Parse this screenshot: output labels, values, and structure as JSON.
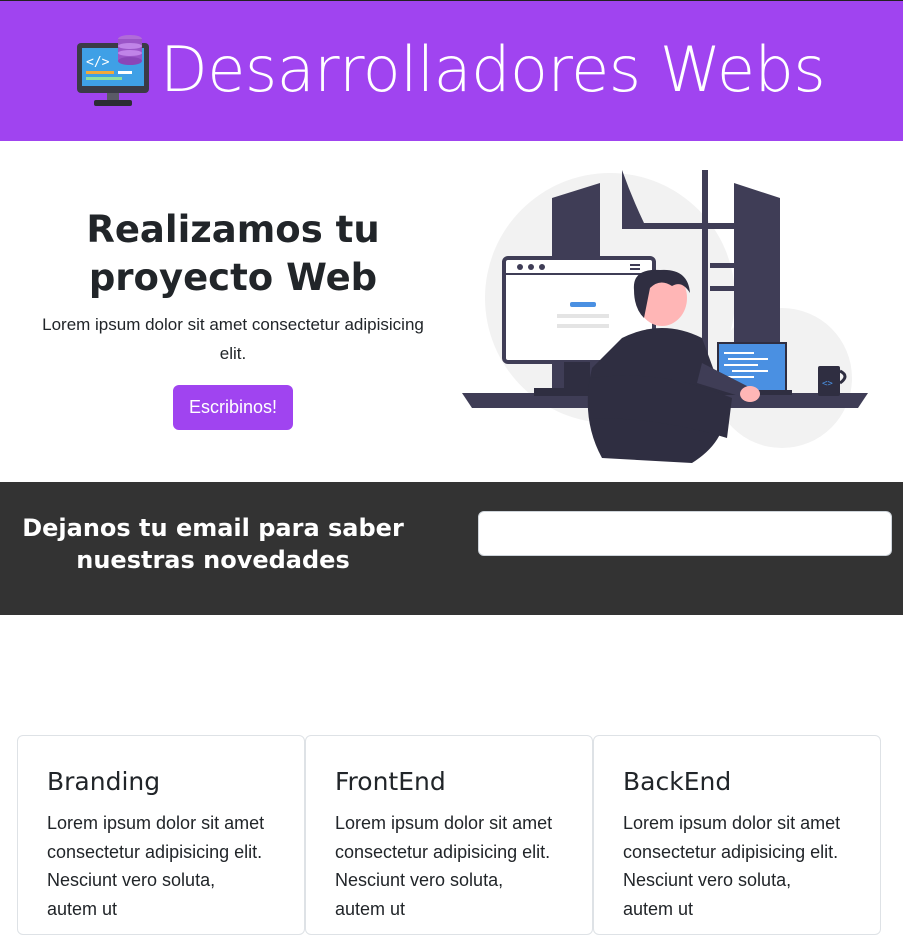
{
  "header": {
    "logo_icon": "monitor-code-database-icon",
    "title": "Desarrolladores Webs",
    "background": "#a044f0"
  },
  "hero": {
    "title": "Realizamos tu proyecto Web",
    "text": "Lorem ipsum dolor sit amet consectetur adipisicing elit.",
    "button_label": "Escribinos!",
    "illustration": "developer-at-desk-illustration"
  },
  "newsletter": {
    "heading": "Dejanos tu email para saber nuestras novedades",
    "input_value": "",
    "background": "#333333"
  },
  "cards": [
    {
      "title": "Branding",
      "text": "Lorem ipsum dolor sit amet consectetur adipisicing elit. Nesciunt vero soluta, autem ut"
    },
    {
      "title": "FrontEnd",
      "text": "Lorem ipsum dolor sit amet consectetur adipisicing elit. Nesciunt vero soluta, autem ut"
    },
    {
      "title": "BackEnd",
      "text": "Lorem ipsum dolor sit amet consectetur adipisicing elit. Nesciunt vero soluta, autem ut"
    }
  ]
}
